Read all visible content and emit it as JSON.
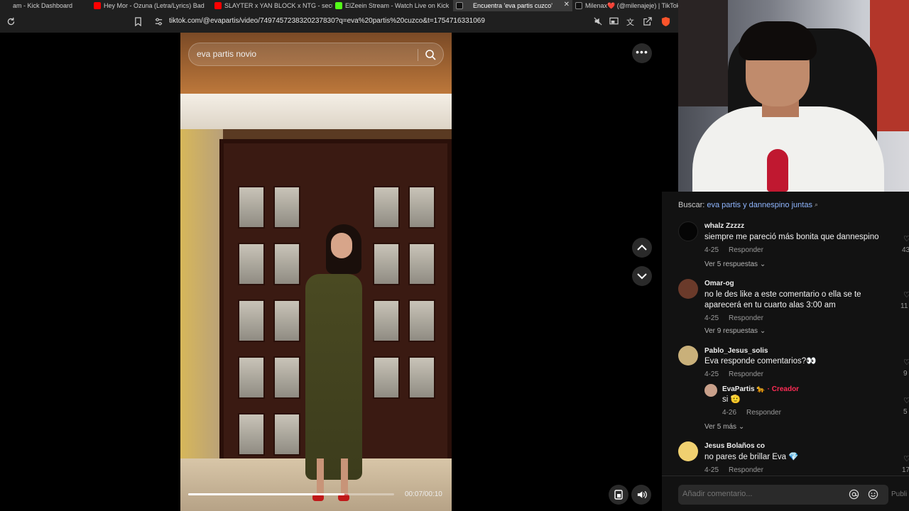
{
  "browser": {
    "tabs": [
      {
        "label": "am - Kick Dashboard",
        "favicon_color": "#53fc18"
      },
      {
        "label": "Hey Mor - Ozuna (Letra/Lyrics) Bad",
        "favicon_color": "#ff0000"
      },
      {
        "label": "SLAYTER x YAN BLOCK x NTG - secu",
        "favicon_color": "#ff0000"
      },
      {
        "label": "ElZeein Stream - Watch Live on Kick",
        "favicon_color": "#53fc18"
      },
      {
        "label": "Encuentra 'eva partis cuzco'",
        "favicon_color": "#ffffff"
      },
      {
        "label": "Milenax❤️ (@milenajeje) | TikTok",
        "favicon_color": "#ffffff"
      }
    ],
    "url": "tiktok.com/@evapartis/video/7497457238320237830?q=eva%20partis%20cuzco&t=1754716331069"
  },
  "video": {
    "search_value": "eva partis novio",
    "elapsed": "00:07",
    "duration": "00:10",
    "time_label": "00:07/00:10",
    "progress_fraction": 0.76
  },
  "comments": {
    "search_prefix": "Buscar:",
    "search_suggestion": "eva partis y dannespino juntas",
    "reply_label": "Responder",
    "items": [
      {
        "user": "whalz Zzzzz",
        "text": "siempre me pareció más bonita que dannespino",
        "date": "4-25",
        "likes": "43",
        "more": "Ver 5 respuestas",
        "avatar_color": "#050505"
      },
      {
        "user": "Omar-og",
        "text": "no le des like a este comentario o ella se te aparecerá en tu cuarto alas 3:00 am",
        "date": "4-25",
        "likes": "11",
        "more": "Ver 9 respuestas",
        "avatar_color": "#6a3a2a"
      },
      {
        "user": "Pablo_Jesus_solis",
        "text": "Eva responde comentarios?👀",
        "date": "4-25",
        "likes": "9",
        "more": "",
        "avatar_color": "#c9b07a"
      },
      {
        "user": "Jesus Bolaños co",
        "text": "no pares de brillar Eva 💎",
        "date": "4-25",
        "likes": "17",
        "more": "",
        "avatar_color": "#f0d070"
      }
    ],
    "reply": {
      "user": "EvaPartis 🐆",
      "badge": "· Creador",
      "text": "si 🫡",
      "date": "4-26",
      "likes": "5",
      "more": "Ver 5 más",
      "avatar_color": "#c9a08a"
    },
    "composer_placeholder": "Añadir comentario...",
    "publish_label": "Publi"
  }
}
